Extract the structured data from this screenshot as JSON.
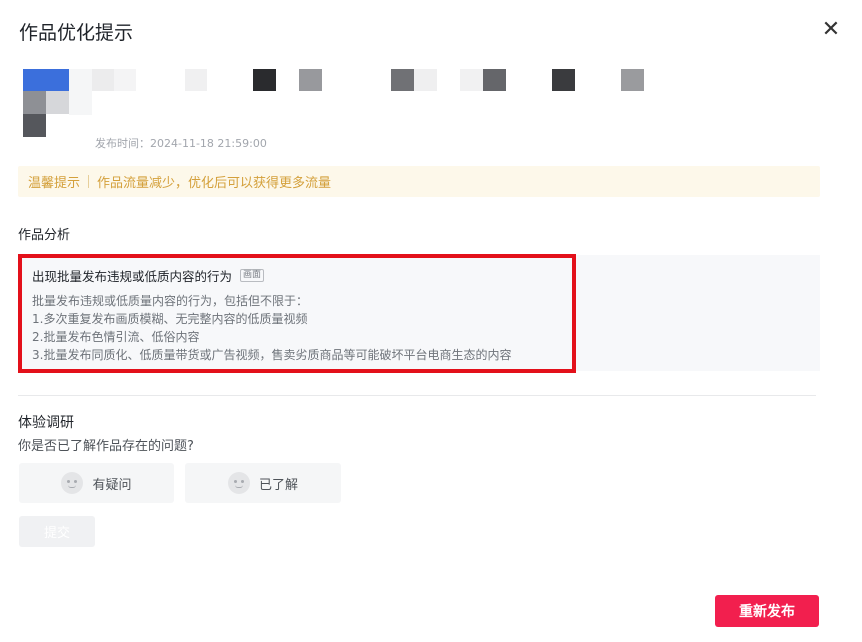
{
  "dialog": {
    "title": "作品优化提示",
    "close_icon": "close-icon"
  },
  "work": {
    "publish_time": "发布时间：2024-11-18 21:59:00"
  },
  "tip": {
    "label": "温馨提示",
    "text": "作品流量减少，优化后可以获得更多流量"
  },
  "analysis": {
    "section_title": "作品分析",
    "issue_title": "出现批量发布违规或低质内容的行为",
    "issue_tag": "画面",
    "lines": [
      "批量发布违规或低质量内容的行为，包括但不限于：",
      " 1.多次重复发布画质模糊、无完整内容的低质量视频",
      " 2.批量发布色情引流、低俗内容",
      " 3.批量发布同质化、低质量带货或广告视频，售卖劣质商品等可能破坏平台电商生态的内容"
    ],
    "highlight_color": "#e3101a"
  },
  "survey": {
    "title": "体验调研",
    "question": "你是否已了解作品存在的问题?",
    "options": [
      {
        "label": "有疑问",
        "icon": "confused-face-icon"
      },
      {
        "label": "已了解",
        "icon": "smile-face-icon"
      }
    ],
    "submit_label": "提交"
  },
  "footer": {
    "republish_label": "重新发布",
    "accent_color": "#f21f4e"
  }
}
